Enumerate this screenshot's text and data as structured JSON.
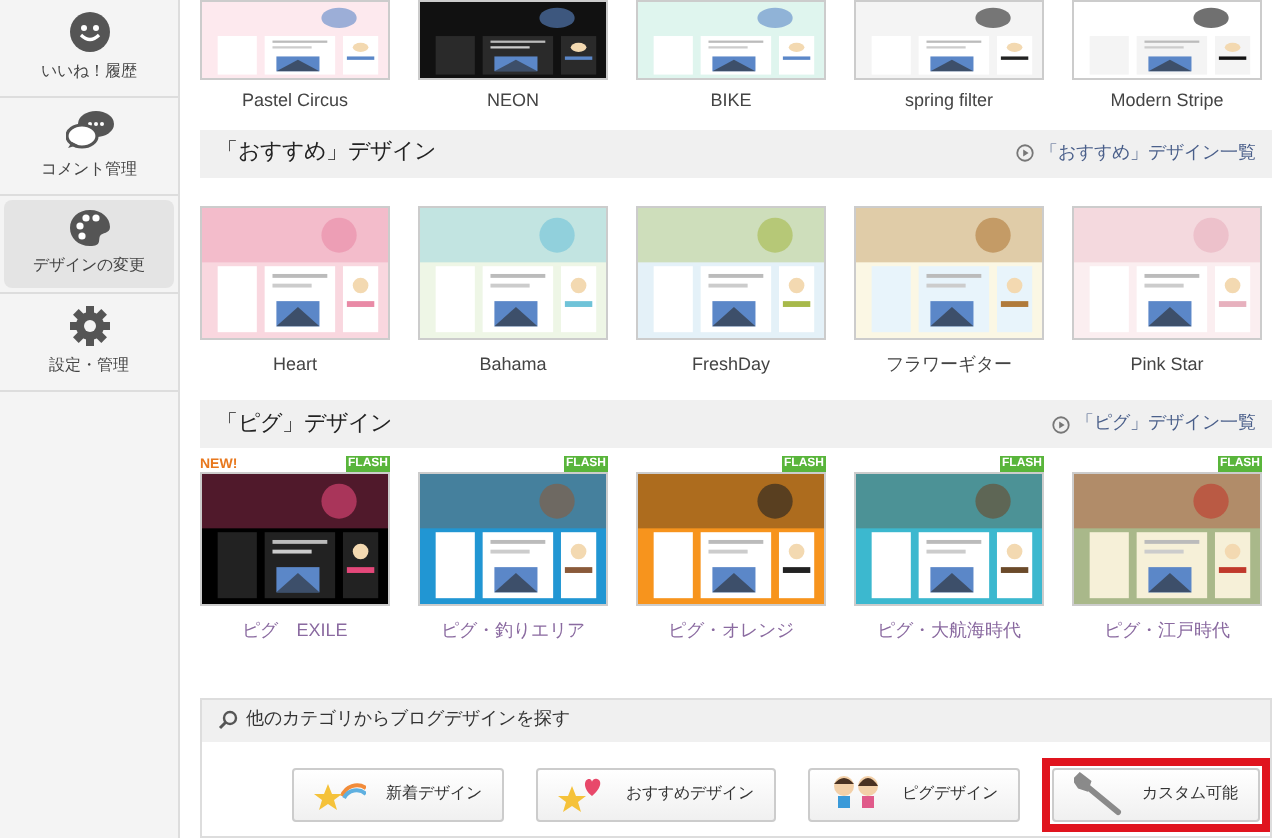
{
  "sidebar": {
    "items": [
      {
        "label": "いいね！履歴",
        "kind": "smiley",
        "selected": false
      },
      {
        "label": "コメント管理",
        "kind": "bubbles",
        "selected": false
      },
      {
        "label": "デザインの変更",
        "kind": "palette",
        "selected": true
      },
      {
        "label": "設定・管理",
        "kind": "gear",
        "selected": false
      }
    ]
  },
  "top_designs": [
    {
      "name": "Pastel Circus"
    },
    {
      "name": "NEON"
    },
    {
      "name": "BIKE"
    },
    {
      "name": "spring filter"
    },
    {
      "name": "Modern Stripe"
    }
  ],
  "sections": [
    {
      "title": "「おすすめ」デザイン",
      "link": "「おすすめ」デザイン一覧",
      "kind": "plain",
      "designs": [
        {
          "name": "Heart"
        },
        {
          "name": "Bahama"
        },
        {
          "name": "FreshDay"
        },
        {
          "name": "フラワーギター"
        },
        {
          "name": "Pink Star"
        }
      ]
    },
    {
      "title": "「ピグ」デザイン",
      "link": "「ピグ」デザイン一覧",
      "kind": "pig",
      "designs": [
        {
          "name": "ピグ　EXILE",
          "badges": [
            {
              "text": "NEW!",
              "kind": "new"
            },
            {
              "text": "FLASH",
              "kind": "flash"
            }
          ]
        },
        {
          "name": "ピグ・釣りエリア",
          "badges": [
            {
              "text": "FLASH",
              "kind": "flash"
            }
          ]
        },
        {
          "name": "ピグ・オレンジ",
          "badges": [
            {
              "text": "FLASH",
              "kind": "flash"
            }
          ]
        },
        {
          "name": "ピグ・大航海時代",
          "badges": [
            {
              "text": "FLASH",
              "kind": "flash"
            }
          ]
        },
        {
          "name": "ピグ・江戸時代",
          "badges": [
            {
              "text": "FLASH",
              "kind": "flash"
            }
          ]
        }
      ]
    }
  ],
  "category_search": {
    "title": "他のカテゴリからブログデザインを探す",
    "buttons": [
      {
        "label": "新着デザイン",
        "kind": "new",
        "highlighted": false
      },
      {
        "label": "おすすめデザイン",
        "kind": "recommended",
        "highlighted": false
      },
      {
        "label": "ピグデザイン",
        "kind": "pig",
        "highlighted": false
      },
      {
        "label": "カスタム可能",
        "kind": "custom",
        "highlighted": true
      }
    ]
  }
}
